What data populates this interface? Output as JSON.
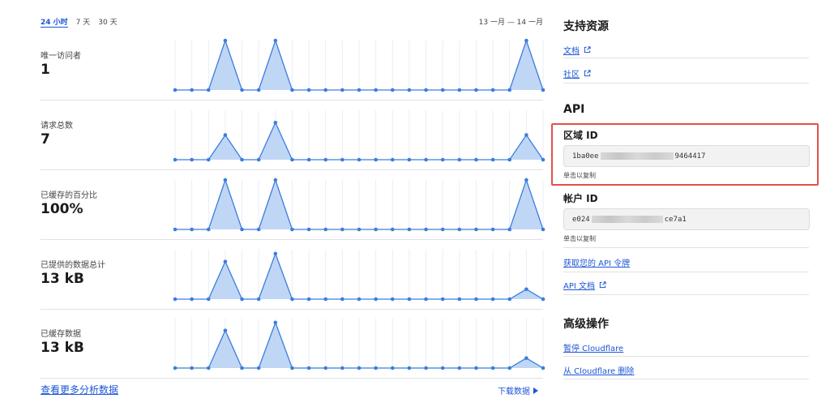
{
  "range_tabs": [
    "24 小时",
    "7 天",
    "30 天"
  ],
  "active_tab": 0,
  "date_range": "13 一月 — 14 一月",
  "metrics": [
    {
      "label": "唯一访问者",
      "value": "1",
      "series": [
        0,
        0,
        0,
        1,
        0,
        0,
        1,
        0,
        0,
        0,
        0,
        0,
        0,
        0,
        0,
        0,
        0,
        0,
        0,
        0,
        0,
        1,
        0
      ]
    },
    {
      "label": "请求总数",
      "value": "7",
      "series": [
        0,
        0,
        0,
        0.5,
        0,
        0,
        0.75,
        0,
        0,
        0,
        0,
        0,
        0,
        0,
        0,
        0,
        0,
        0,
        0,
        0,
        0,
        0.5,
        0
      ]
    },
    {
      "label": "已缓存的百分比",
      "value": "100%",
      "series": [
        0,
        0,
        0,
        1,
        0,
        0,
        1,
        0,
        0,
        0,
        0,
        0,
        0,
        0,
        0,
        0,
        0,
        0,
        0,
        0,
        0,
        1,
        0
      ]
    },
    {
      "label": "已提供的数据总计",
      "value": "13 kB",
      "series": [
        0,
        0,
        0,
        0.76,
        0,
        0,
        0.92,
        0,
        0,
        0,
        0,
        0,
        0,
        0,
        0,
        0,
        0,
        0,
        0,
        0,
        0,
        0.2,
        0
      ]
    },
    {
      "label": "已缓存数据",
      "value": "13 kB",
      "series": [
        0,
        0,
        0,
        0.76,
        0,
        0,
        0.92,
        0,
        0,
        0,
        0,
        0,
        0,
        0,
        0,
        0,
        0,
        0,
        0,
        0,
        0,
        0.2,
        0
      ]
    }
  ],
  "more_analytics_link": "查看更多分析数据",
  "download_link": "下载数据",
  "support": {
    "title": "支持资源",
    "docs_link": "文档",
    "community_link": "社区"
  },
  "api": {
    "title": "API",
    "zone_id_label": "区域 ID",
    "zone_id_prefix": "1ba0ee",
    "zone_id_suffix": "9464417",
    "copy_hint": "单击以复制",
    "account_id_label": "帐户 ID",
    "account_id_prefix": "e024",
    "account_id_suffix": "ce7a1",
    "copy_hint_2": "单击以复制",
    "token_link": "获取您的 API 令牌",
    "api_docs_link": "API 文档"
  },
  "advanced": {
    "title": "高级操作",
    "pause_link": "暂停 Cloudflare",
    "remove_link": "从 Cloudflare 删除"
  },
  "colors": {
    "accent": "#1c56d6",
    "chart_line": "#3b7ddd",
    "chart_fill": "#b5cff3",
    "highlight": "#e2504c"
  }
}
